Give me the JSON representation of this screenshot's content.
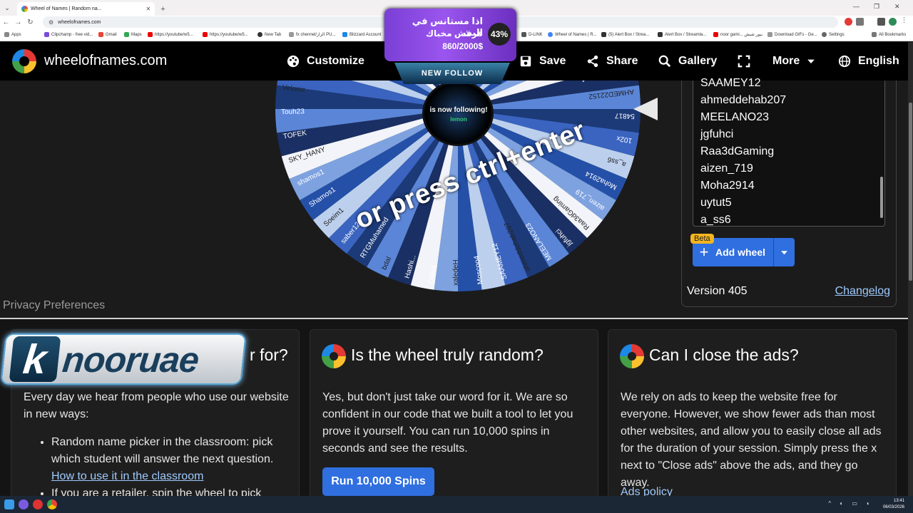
{
  "browser": {
    "tab_title": "Wheel of Names | Random na...",
    "url": "wheelofnames.com",
    "bookmarks": [
      "Apps",
      "Clipchamp - free vid...",
      "Gmail",
      "Maps",
      "https://youtube/w5...",
      "https://youtube/w5...",
      "New Tab",
      "fx chennel/الزار PU...",
      "Blizzard Account",
      "D-LINK",
      "Wheel of Names | R...",
      "(5) Alert Box / Strea...",
      "Alert Box / Streamla...",
      "noor gami... بيور شيش",
      "Download GIFs - Ge...",
      "Settings",
      "All Bookmarks"
    ]
  },
  "site": {
    "title": "wheelofnames.com",
    "menu": [
      "Customize",
      "Save",
      "Share",
      "Gallery",
      "More",
      "English"
    ]
  },
  "wheel": {
    "press_text": "or press ctrl+enter",
    "center_text": "is now following!",
    "center_sub": "lemon",
    "left_labels": [
      "Qasoj",
      "Hashi...",
      "bdal",
      "RTGMuhamed",
      "saber123",
      "Soeim1",
      "Shamos1",
      "shamos1",
      "SKY_HANY",
      "TOFEK",
      "Touh23",
      "Velonic",
      "Volk123"
    ],
    "right_labels": [
      "AhmedHisham1",
      "AHMED22152",
      "54817",
      "102x"
    ],
    "bottom_labels": [
      "xaledeH",
      "Moscoo4",
      "SAAMEY12",
      "ahmeddehab207",
      "MEELANO23",
      "jgfuhci",
      "Raa3dGaming",
      "aizen_719",
      "Moha2914",
      "a_ss6"
    ]
  },
  "entries": {
    "names": [
      "SAAMEY12",
      "ahmeddehab207",
      "MEELANO23",
      "jgfuhci",
      "Raa3dGaming",
      "aizen_719",
      "Moha2914",
      "uytut5",
      "a_ss6"
    ],
    "beta": "Beta",
    "add_wheel": "Add wheel",
    "version": "Version 405",
    "changelog": "Changelog"
  },
  "privacy": "Privacy Preferences",
  "faq": [
    {
      "title_tail": "r for?",
      "body": "Every day we hear from people who use our website in new ways:",
      "bullet1": "Random name picker in the classroom: pick which student will answer the next question.",
      "bullet1_link": "How to use it in the classroom",
      "bullet2": "If you are a retailer, spin the wheel to pick"
    },
    {
      "title": "Is the wheel truly random?",
      "body": "Yes, but don't just take our word for it. We are so confident in our code that we built a tool to let you prove it yourself. You can run 10,000 spins in seconds and see the results.",
      "button": "Run 10,000 Spins"
    },
    {
      "title": "Can I close the ads?",
      "body": "We rely on ads to keep the website free for everyone. However, we show fewer ads than most other websites, and allow you to easily close all ads for the duration of your session. Simply press the x next to \"Close ads\" above the ads, and they go away.",
      "link": "Ads policy"
    }
  ],
  "alert": {
    "title": "اذا مستانس في البث",
    "subtitle": "قرقش مخباك",
    "amount": "860/2000$",
    "percent": "43%",
    "progress": 0.43
  },
  "follow_banner": "NEW FOLLOW",
  "brand": {
    "letter": "k",
    "name": "nooruae"
  },
  "taskbar": {
    "time": "13:41",
    "date": "06/03/2026"
  },
  "colors": {
    "accent": "#2f6fe0",
    "link": "#9ecbff",
    "beta": "#f5b51e",
    "alert_purple": "#9a55ee"
  }
}
